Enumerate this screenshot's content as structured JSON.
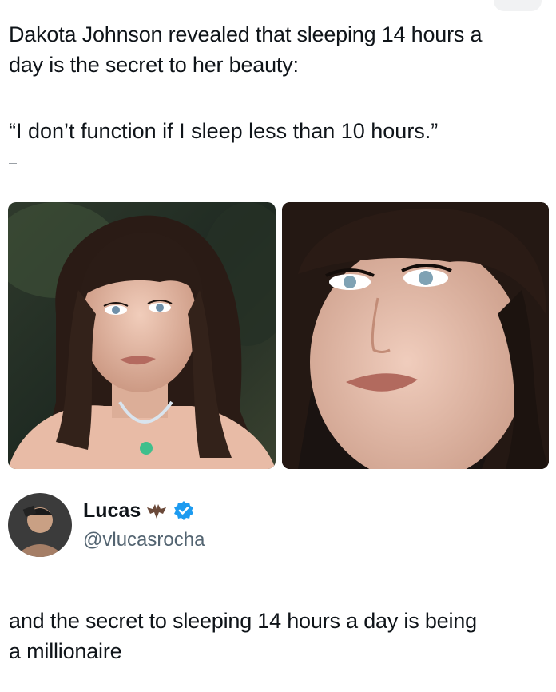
{
  "post": {
    "line1": "Dakota Johnson revealed that sleeping 14 hours a",
    "line2": "day is the secret to her beauty:",
    "quote": "“I don’t function if I sleep less than 10 hours.”"
  },
  "photos": [
    {
      "name": "photo-left"
    },
    {
      "name": "photo-right"
    }
  ],
  "reply": {
    "display_name": "Lucas",
    "handle": "@vlucasrocha",
    "verified_icon": "verified-badge-icon",
    "name_emoji_icon": "bat-emoji-icon",
    "text_line1": "and the secret to sleeping 14 hours a day is being",
    "text_line2": "a millionaire"
  },
  "colors": {
    "text": "#0f1419",
    "handle": "#536471",
    "verified": "#1d9bf0"
  }
}
